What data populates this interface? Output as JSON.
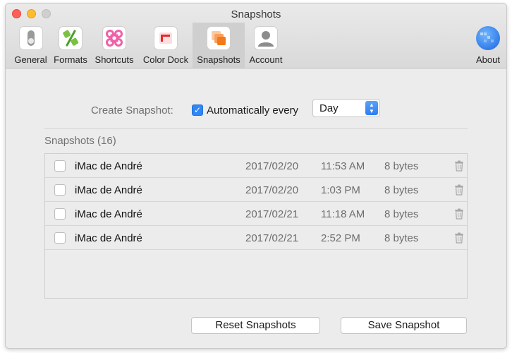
{
  "window": {
    "title": "Snapshots"
  },
  "tabs": [
    {
      "label": "General",
      "icon": "toggle-switch-icon"
    },
    {
      "label": "Formats",
      "icon": "percent-icon"
    },
    {
      "label": "Shortcuts",
      "icon": "command-key-icon"
    },
    {
      "label": "Color Dock",
      "icon": "color-dock-icon"
    },
    {
      "label": "Snapshots",
      "icon": "snapshots-stack-icon",
      "selected": true
    },
    {
      "label": "Account",
      "icon": "user-silhouette-icon"
    },
    {
      "label": "About",
      "icon": "globe-app-icon"
    }
  ],
  "create": {
    "label": "Create Snapshot:",
    "auto_label": "Automatically every",
    "auto_checked": true,
    "interval": "Day"
  },
  "snapshots": {
    "header": "Snapshots (16)",
    "rows": [
      {
        "name": "iMac de André",
        "date": "2017/02/20",
        "time": "11:53 AM",
        "size": "8 bytes"
      },
      {
        "name": "iMac de André",
        "date": "2017/02/20",
        "time": "1:03 PM",
        "size": "8 bytes"
      },
      {
        "name": "iMac de André",
        "date": "2017/02/21",
        "time": "11:18 AM",
        "size": "8 bytes"
      },
      {
        "name": "iMac de André",
        "date": "2017/02/21",
        "time": "2:52 PM",
        "size": "8 bytes"
      }
    ]
  },
  "buttons": {
    "reset": "Reset Snapshots",
    "save": "Save Snapshot"
  },
  "colors": {
    "accent": "#2f86f6",
    "selected_tab": "#cfcfcf",
    "window_bg": "#ececec"
  }
}
